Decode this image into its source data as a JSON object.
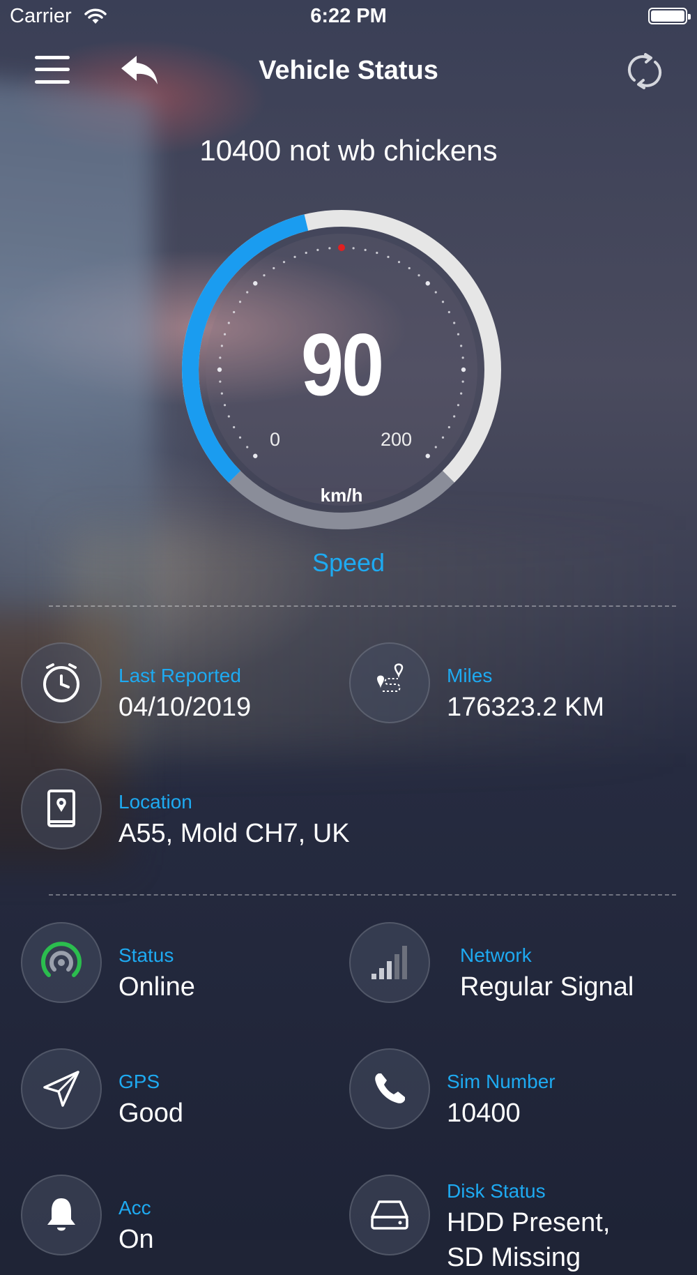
{
  "status_bar": {
    "carrier": "Carrier",
    "time": "6:22 PM"
  },
  "nav": {
    "title": "Vehicle Status",
    "menu_icon": "hamburger-menu-icon",
    "back_icon": "back-arrow-icon",
    "refresh_icon": "refresh-icon"
  },
  "vehicle": {
    "name": "10400 not wb chickens"
  },
  "gauge": {
    "value": "90",
    "min_label": "0",
    "max_label": "200",
    "unit": "km/h",
    "label": "Speed",
    "speed": 90,
    "max": 200,
    "colors": {
      "active": "#1a9cf0",
      "track": "#e6e6e6",
      "lower": "#8a8d99",
      "marker": "#e02020"
    }
  },
  "info_top": {
    "last_reported": {
      "label": "Last Reported",
      "value": "04/10/2019",
      "icon": "clock-icon"
    },
    "miles": {
      "label": "Miles",
      "value": "176323.2 KM",
      "icon": "route-icon"
    },
    "location": {
      "label": "Location",
      "value": "A55, Mold CH7, UK",
      "icon": "map-book-icon"
    }
  },
  "info_bottom": {
    "status": {
      "label": "Status",
      "value": "Online",
      "icon": "online-signal-icon",
      "color": "#2bbd4e"
    },
    "network": {
      "label": "Network",
      "value": "Regular Signal",
      "icon": "signal-bars-icon"
    },
    "gps": {
      "label": "GPS",
      "value": "Good",
      "icon": "navigation-arrow-icon"
    },
    "sim": {
      "label": "Sim Number",
      "value": "10400",
      "icon": "phone-icon"
    },
    "acc": {
      "label": "Acc",
      "value": "On",
      "icon": "bell-icon"
    },
    "disk": {
      "label": "Disk Status",
      "value": "HDD Present,",
      "value_line2": "SD Missing",
      "icon": "hard-drive-icon"
    }
  },
  "colors": {
    "accent": "#1eaaf1"
  }
}
